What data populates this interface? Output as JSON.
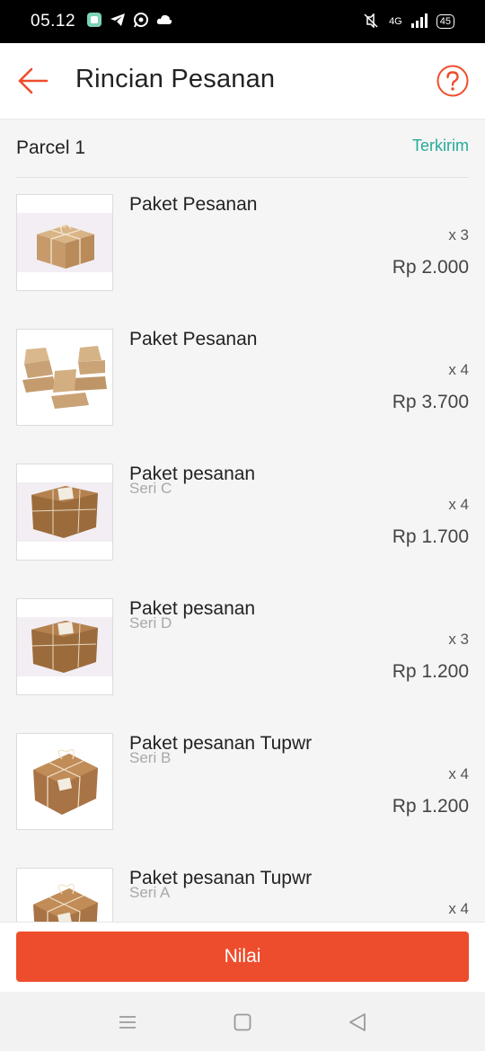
{
  "status_bar": {
    "time": "05.12",
    "network": "4G",
    "battery": "45",
    "icons": [
      "app-icon",
      "telegram-icon",
      "whatsapp-icon",
      "cloud-icon",
      "mute-icon",
      "signal-icon",
      "battery-icon"
    ]
  },
  "header": {
    "title": "Rincian Pesanan",
    "back_icon": "arrow-left-icon",
    "help_icon": "question-circle-icon"
  },
  "parcel": {
    "title": "Parcel 1",
    "status": "Terkirim"
  },
  "items": [
    {
      "name": "Paket Pesanan",
      "variant": "",
      "qty": "x 3",
      "price": "Rp 2.000",
      "image": "kraft-gift-box"
    },
    {
      "name": "Paket Pesanan",
      "variant": "",
      "qty": "x 4",
      "price": "Rp 3.700",
      "image": "kraft-food-boxes"
    },
    {
      "name": "Paket pesanan",
      "variant": "Seri C",
      "qty": "x 4",
      "price": "Rp 1.700",
      "image": "parcel-with-tag"
    },
    {
      "name": "Paket pesanan",
      "variant": "Seri D",
      "qty": "x 3",
      "price": "Rp 1.200",
      "image": "parcel-with-tag"
    },
    {
      "name": "Paket pesanan Tupwr",
      "variant": "Seri B",
      "qty": "x 4",
      "price": "Rp 1.200",
      "image": "twine-gift-box"
    },
    {
      "name": "Paket pesanan Tupwr",
      "variant": "Seri A",
      "qty": "x 4",
      "price": "",
      "image": "twine-gift-box"
    }
  ],
  "action": {
    "rate_label": "Nilai"
  },
  "nav": {
    "icons": [
      "menu-icon",
      "home-icon",
      "back-icon"
    ]
  },
  "colors": {
    "accent": "#ee4d2d",
    "status": "#26aa99"
  }
}
